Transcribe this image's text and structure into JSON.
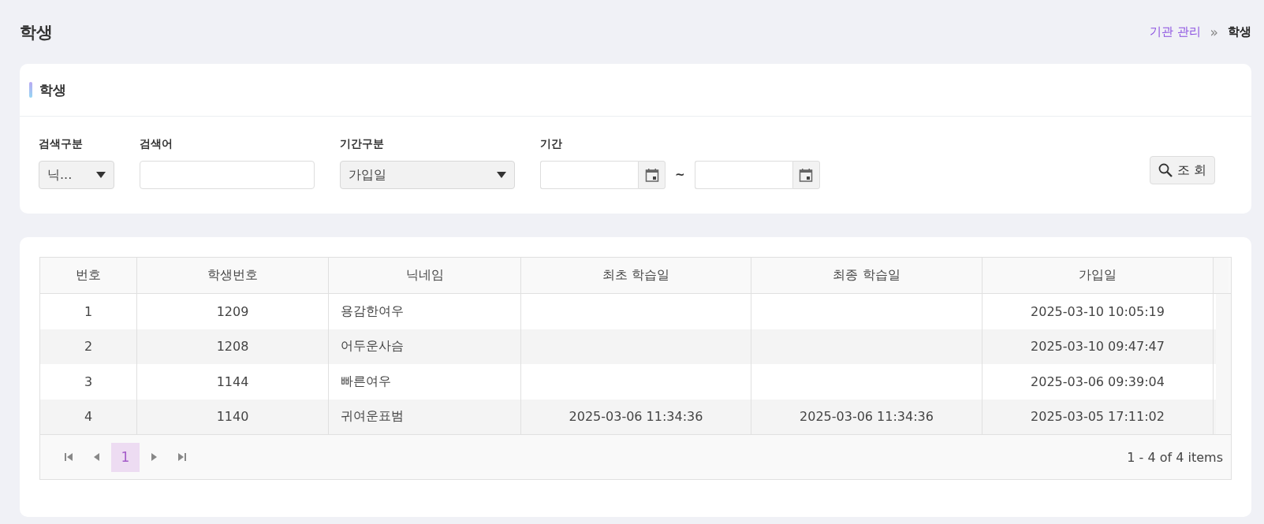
{
  "page": {
    "title": "학생",
    "breadcrumb": [
      {
        "label": "기관 관리",
        "kind": "link"
      },
      {
        "label": "학생",
        "kind": "current"
      }
    ],
    "separator": "»"
  },
  "filter": {
    "title": "학생",
    "fields": [
      {
        "label": "검색구분",
        "kind": "select",
        "value": "닉..."
      },
      {
        "label": "검색어",
        "kind": "text"
      },
      {
        "label": "기간구분",
        "kind": "select",
        "value": "가입일"
      },
      {
        "label": "기간",
        "kind": "date_range",
        "separator": "~"
      }
    ],
    "button": "조 회"
  },
  "table": {
    "columns": [
      "번호",
      "학생번호",
      "닉네임",
      "최초 학습일",
      "최종 학습일",
      "가입일"
    ],
    "rows": [
      [
        "1",
        "1209",
        "용감한여우",
        null,
        null,
        "2025-03-10 10:05:19"
      ],
      [
        "2",
        "1208",
        "어두운사슴",
        null,
        null,
        "2025-03-10 09:47:47"
      ],
      [
        "3",
        "1144",
        "빠른여우",
        null,
        null,
        "2025-03-06 09:39:04"
      ],
      [
        "4",
        "1140",
        "귀여운표범",
        "2025-03-06 11:34:36",
        "2025-03-06 11:34:36",
        "2025-03-05 17:11:02"
      ]
    ],
    "pager": {
      "pages": [
        {
          "label": "1",
          "selected": true
        }
      ],
      "info": "1 - 4 of 4 items"
    }
  }
}
